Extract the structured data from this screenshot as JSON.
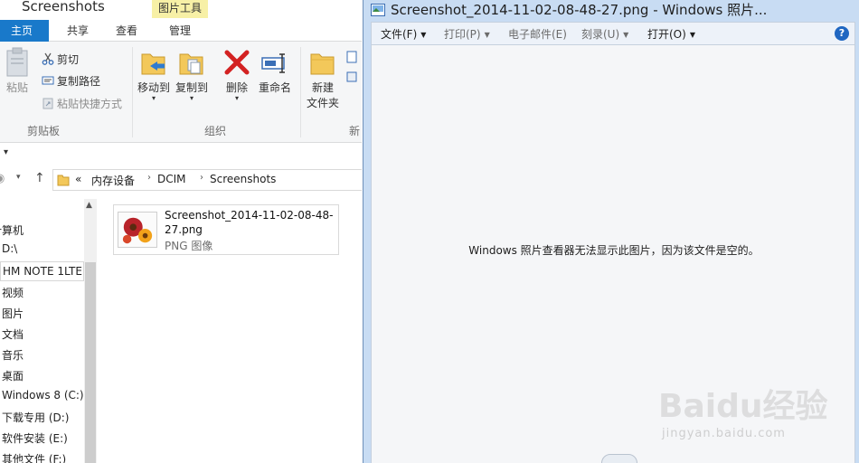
{
  "explorer": {
    "title": "Screenshots",
    "contextual_tab": "图片工具",
    "tabs": [
      "主页",
      "共享",
      "查看",
      "管理"
    ],
    "ribbon": {
      "clipboard": {
        "paste": "粘贴",
        "cut": "剪切",
        "copy_path": "复制路径",
        "paste_shortcut": "粘贴快捷方式",
        "group": "剪贴板"
      },
      "organize": {
        "move_to": "移动到",
        "copy_to": "复制到",
        "delete": "删除",
        "rename": "重命名",
        "group": "组织"
      },
      "new": {
        "new_folder_line1": "新建",
        "new_folder_line2": "文件夹",
        "group": "新"
      }
    },
    "address": {
      "overflow": "«",
      "crumbs": [
        "内存设备",
        "DCIM",
        "Screenshots"
      ]
    },
    "nav": {
      "items": [
        "计算机",
        "D:\\",
        "HM NOTE 1LTE",
        "视频",
        "图片",
        "文档",
        "音乐",
        "桌面",
        "Windows 8 (C:)",
        "下载专用 (D:)",
        "软件安装 (E:)",
        "其他文件 (F:)"
      ]
    },
    "file": {
      "name": "Screenshot_2014-11-02-08-48-27.png",
      "type": "PNG 图像"
    }
  },
  "viewer": {
    "title": "Screenshot_2014-11-02-08-48-27.png - Windows 照片...",
    "menu": [
      {
        "label": "文件(F)",
        "enabled": true
      },
      {
        "label": "打印(P)",
        "enabled": false
      },
      {
        "label": "电子邮件(E)",
        "enabled": false
      },
      {
        "label": "刻录(U)",
        "enabled": false
      },
      {
        "label": "打开(O)",
        "enabled": true
      }
    ],
    "help": "?",
    "message": "Windows 照片查看器无法显示此图片，因为该文件是空的。"
  },
  "watermark": {
    "brand": "Baidu经验",
    "url": "jingyan.baidu.com"
  },
  "colors": {
    "home_tab": "#1979ca",
    "contextual_tab": "#f7f0a6",
    "viewer_frame": "#c8dcf3"
  }
}
